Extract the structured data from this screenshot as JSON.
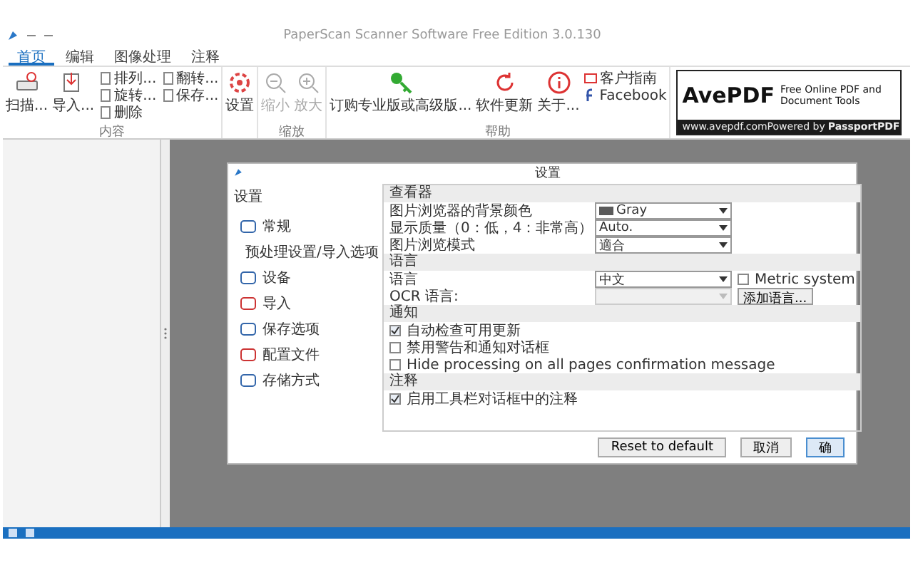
{
  "window": {
    "title": "PaperScan Scanner Software Free Edition 3.0.130"
  },
  "tabs": [
    {
      "label": "首页",
      "selected": true
    },
    {
      "label": "编辑",
      "selected": false
    },
    {
      "label": "图像处理",
      "selected": false
    },
    {
      "label": "注释",
      "selected": false
    }
  ],
  "ribbon": {
    "groups": [
      {
        "label": "内容",
        "items": [
          {
            "kind": "large",
            "label": "扫描..."
          },
          {
            "kind": "large",
            "label": "导入..."
          },
          {
            "kind": "small",
            "label": "排列..."
          },
          {
            "kind": "small",
            "label": "旋转..."
          },
          {
            "kind": "small",
            "label": "删除"
          },
          {
            "kind": "small",
            "label": "翻转..."
          },
          {
            "kind": "small",
            "label": "保存..."
          }
        ]
      },
      {
        "items": [
          {
            "kind": "large",
            "label": "设置"
          }
        ]
      },
      {
        "label": "缩放",
        "items": [
          {
            "kind": "large",
            "label": "缩小",
            "disabled": true
          },
          {
            "kind": "large",
            "label": "放大",
            "disabled": true
          }
        ]
      },
      {
        "label": "帮助",
        "items": [
          {
            "kind": "large",
            "label": "订购专业版或高级版..."
          },
          {
            "kind": "large",
            "label": "软件更新"
          },
          {
            "kind": "large",
            "label": "关于..."
          },
          {
            "kind": "small",
            "label": "客户指南"
          },
          {
            "kind": "small",
            "label": "Facebook"
          }
        ]
      }
    ]
  },
  "ad": {
    "brand": "AvePDF",
    "tagline": "Free Online PDF and Document Tools",
    "url": "www.avepdf.com",
    "powered_by": "Powered by",
    "powered_brand": "PassportPDF"
  },
  "dialog": {
    "title": "设置",
    "nav_title": "设置",
    "nav": [
      {
        "label": "常规"
      },
      {
        "label": "预处理设置/导入选项"
      },
      {
        "label": "设备"
      },
      {
        "label": "导入"
      },
      {
        "label": "保存选项"
      },
      {
        "label": "配置文件"
      },
      {
        "label": "存储方式"
      }
    ],
    "sections": [
      {
        "title": "查看器",
        "rows": [
          {
            "kind": "select",
            "label": "图片浏览器的背景颜色",
            "value": "Gray",
            "color": "#5a5a5a"
          },
          {
            "kind": "select",
            "label": "显示质量（0：低，4：非常高）",
            "value": "Auto."
          },
          {
            "kind": "select",
            "label": "图片浏览模式",
            "value": "適合"
          }
        ]
      },
      {
        "title": "语言",
        "rows": [
          {
            "kind": "select",
            "label": "语言",
            "value": "中文",
            "aside": {
              "kind": "check",
              "label": "Metric system",
              "checked": false
            }
          },
          {
            "kind": "select",
            "label": "OCR 语言:",
            "disabled": true,
            "aside": {
              "kind": "button",
              "label": "添加语言..."
            }
          }
        ]
      },
      {
        "title": "通知",
        "rows": [
          {
            "kind": "check",
            "label": "自动检查可用更新",
            "checked": true
          },
          {
            "kind": "check",
            "label": "禁用警告和通知对话框",
            "checked": false
          },
          {
            "kind": "check",
            "label": "Hide processing on all pages confirmation message",
            "checked": false
          }
        ]
      },
      {
        "title": "注释",
        "rows": [
          {
            "kind": "check",
            "label": "启用工具栏对话框中的注释",
            "checked": true
          }
        ]
      }
    ],
    "buttons": [
      {
        "kind": "secondary",
        "label": "Reset to default"
      },
      {
        "kind": "secondary",
        "label": "取消"
      },
      {
        "kind": "primary",
        "label": "确"
      }
    ]
  }
}
